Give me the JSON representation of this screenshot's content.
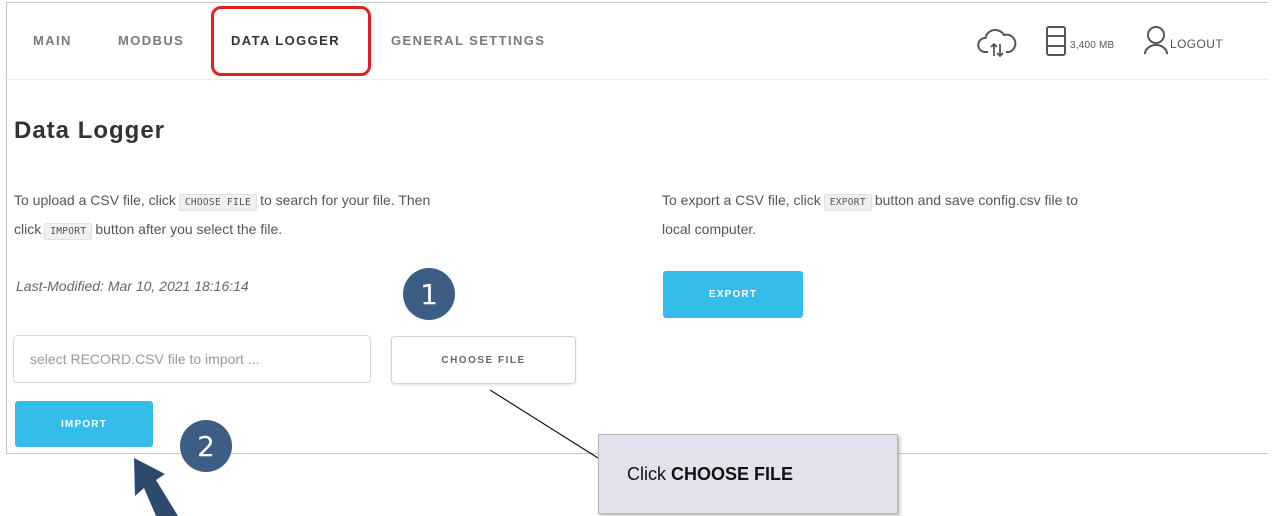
{
  "nav": {
    "items": [
      {
        "label": "MAIN"
      },
      {
        "label": "MODBUS"
      },
      {
        "label": "DATA LOGGER"
      },
      {
        "label": "GENERAL SETTINGS"
      }
    ],
    "active_index": 2,
    "storage": "3,400 MB",
    "logout": "LOGOUT"
  },
  "page": {
    "title": "Data Logger",
    "upload": {
      "text1": "To upload a CSV file, click",
      "code1": "CHOOSE FILE",
      "text2": "to search for your file. Then",
      "text3": "click",
      "code2": "IMPORT",
      "text4": "button after you select the file."
    },
    "export": {
      "text1": "To export a CSV file, click",
      "code1": "EXPORT",
      "text2": "button and save config.csv file to",
      "text3": "local computer."
    },
    "last_modified": "Last-Modified: Mar 10, 2021 18:16:14",
    "file_input_placeholder": "select RECORD.CSV file to import ...",
    "choose_file_label": "CHOOSE FILE",
    "import_label": "IMPORT",
    "export_label": "EXPORT"
  },
  "annotations": {
    "step1": "1",
    "step2": "2",
    "callout_prefix": "Click",
    "callout_bold": "CHOOSE FILE"
  },
  "colors": {
    "accent": "#34bde8",
    "highlight": "#e02020",
    "step": "#3c5e85"
  }
}
